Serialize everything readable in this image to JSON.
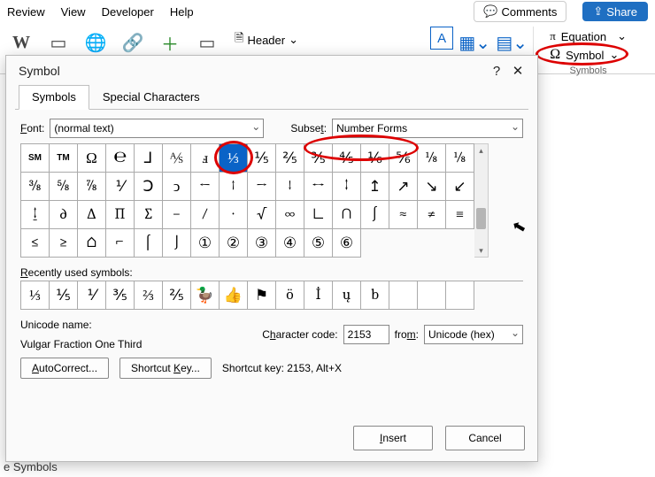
{
  "menubar": {
    "items": [
      "Review",
      "View",
      "Developer",
      "Help"
    ],
    "comments": "Comments",
    "share": "Share"
  },
  "ribbon": {
    "header": "Header",
    "symbols_group": {
      "equation": "Equation",
      "symbol": "Symbol",
      "caption": "Symbols"
    }
  },
  "dialog": {
    "title": "Symbol",
    "help": "?",
    "tabs": {
      "symbols": "Symbols",
      "special": "Special Characters"
    },
    "font_label": "Font:",
    "font_value": "(normal text)",
    "subset_label": "Subset:",
    "subset_value": "Number Forms",
    "grid": [
      "℠",
      "™",
      "Ω",
      "℮",
      "⅃",
      "⅍",
      "ⅎ",
      "⅓",
      "⅕",
      "⅖",
      "⅗",
      "⅘",
      "⅙",
      "⅚",
      "⅛",
      "⅛",
      "⅜",
      "⅝",
      "⅞",
      "⅟",
      "Ↄ",
      "ↄ",
      "←",
      "↑",
      "→",
      "↓",
      "↔",
      "↕",
      "↥",
      "↗",
      "↘",
      "↙",
      "↨",
      "∂",
      "∆",
      "∏",
      "∑",
      "−",
      "∕",
      "∙",
      "√",
      "∞",
      "∟",
      "∩",
      "∫",
      "≈",
      "≠",
      "≡",
      "≤",
      "≥",
      "⌂",
      "⌐",
      "⌠",
      "⌡",
      "①",
      "②",
      "③",
      "④",
      "⑤",
      "⑥"
    ],
    "selected_index": 7,
    "recent_label": "Recently used symbols:",
    "recent": [
      "⅓",
      "⅕",
      "⅟",
      "⅗",
      "⅔",
      "⅖",
      "🦆",
      "👍",
      "⚑",
      "ö",
      "İ",
      "ų",
      "b",
      "",
      "",
      ""
    ],
    "unicode_name_label": "Unicode name:",
    "unicode_name_value": "Vulgar Fraction One Third",
    "char_code_label_pre": "C",
    "char_code_label_u": "h",
    "char_code_label_post": "aracter code:",
    "char_code_value": "2153",
    "from_label_pre": "fro",
    "from_label_u": "m",
    "from_label_post": ":",
    "from_value": "Unicode (hex)",
    "autocorrect": "AutoCorrect...",
    "shortcut_key": "Shortcut Key...",
    "shortcut_text": "Shortcut key: 2153, Alt+X",
    "insert": "Insert",
    "cancel": "Cancel"
  },
  "footer_hint": "e Symbols"
}
